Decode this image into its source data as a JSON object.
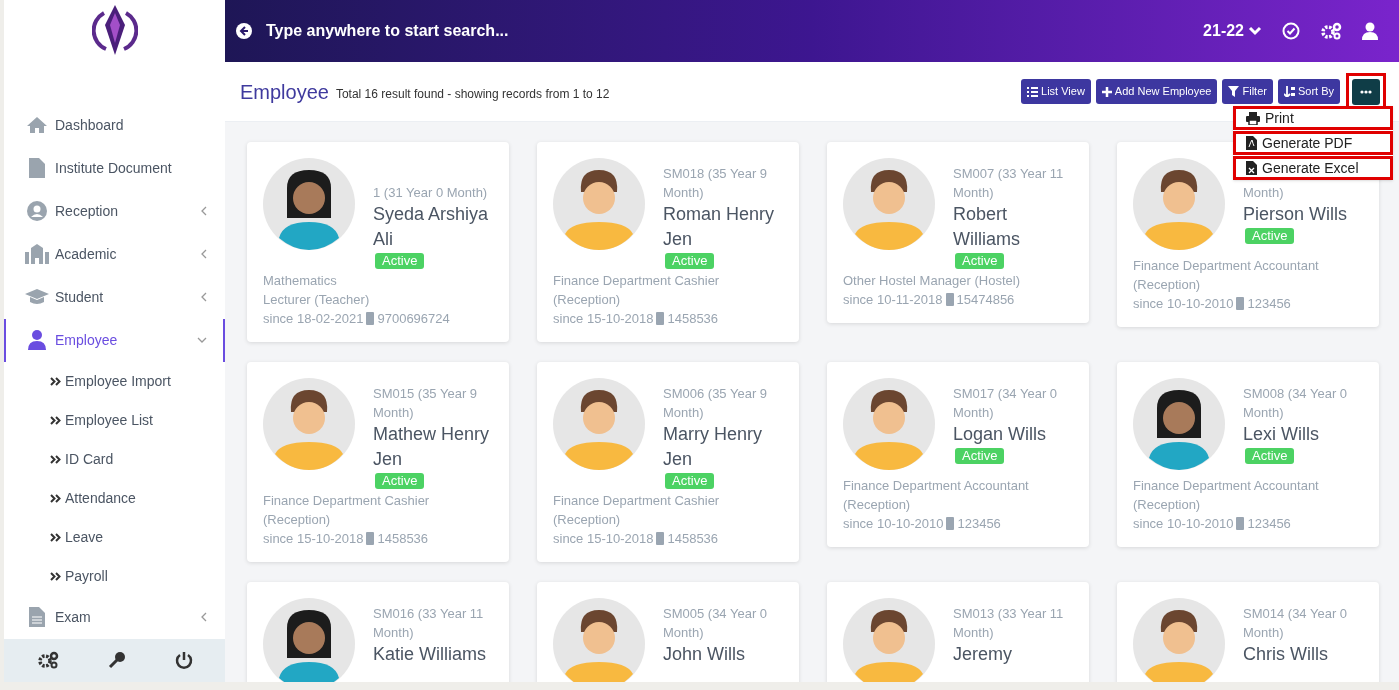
{
  "search": {
    "placeholder": "Type anywhere to start search..."
  },
  "topbar": {
    "session": "21-22"
  },
  "sidebar": {
    "items": [
      {
        "label": "Dashboard",
        "selected": false
      },
      {
        "label": "Institute Document",
        "selected": false
      },
      {
        "label": "Reception",
        "selected": false,
        "expanded": false
      },
      {
        "label": "Academic",
        "selected": false,
        "expanded": false
      },
      {
        "label": "Student",
        "selected": false,
        "expanded": false
      },
      {
        "label": "Employee",
        "selected": true,
        "expanded": true,
        "children": [
          {
            "label": "Employee Import"
          },
          {
            "label": "Employee List"
          },
          {
            "label": "ID Card"
          },
          {
            "label": "Attendance"
          },
          {
            "label": "Leave"
          },
          {
            "label": "Payroll"
          }
        ]
      },
      {
        "label": "Exam",
        "selected": false,
        "expanded": false
      }
    ]
  },
  "page": {
    "title": "Employee",
    "summary": "Total 16 result found - showing records from 1 to 12"
  },
  "toolbar": [
    {
      "label": "List View",
      "highlighted": false
    },
    {
      "label": "Add New Employee",
      "highlighted": false
    },
    {
      "label": "Filter",
      "highlighted": false
    },
    {
      "label": "Sort By",
      "highlighted": false
    }
  ],
  "more_button": {
    "highlighted": true,
    "expanded": true
  },
  "more_menu": [
    {
      "label": "Print",
      "highlighted": true
    },
    {
      "label": "Generate PDF",
      "highlighted": true
    },
    {
      "label": "Generate Excel",
      "highlighted": true
    }
  ],
  "cards": [
    {
      "kind": "female",
      "code": "1 (31 Year 0 Month)",
      "name": "Syeda Arshiya Ali",
      "status": "Active",
      "subject": "Mathematics",
      "role": "Lecturer (Teacher)",
      "since": "since 18-02-2021",
      "phone": "9700696724"
    },
    {
      "kind": "male",
      "code": "SM018 (35 Year 9 Month)",
      "name": "Roman Henry Jen",
      "status": "Active",
      "role": "Finance Department Cashier (Reception)",
      "since": "since 15-10-2018",
      "phone": "1458536"
    },
    {
      "kind": "male",
      "code": "SM007 (33 Year 11 Month)",
      "name": "Robert Williams",
      "status": "Active",
      "role": "Other Hostel Manager (Hostel)",
      "since": "since 10-11-2018",
      "phone": "15474856"
    },
    {
      "kind": "male",
      "code": "Month)",
      "name": "Pierson Wills",
      "status": "Active",
      "role": "Finance Department Accountant (Reception)",
      "since": "since 10-10-2010",
      "phone": "123456"
    },
    {
      "kind": "male",
      "code": "SM015 (35 Year 9 Month)",
      "name": "Mathew Henry Jen",
      "status": "Active",
      "role": "Finance Department Cashier (Reception)",
      "since": "since 15-10-2018",
      "phone": "1458536"
    },
    {
      "kind": "male",
      "code": "SM006 (35 Year 9 Month)",
      "name": "Marry Henry Jen",
      "status": "Active",
      "role": "Finance Department Cashier (Reception)",
      "since": "since 15-10-2018",
      "phone": "1458536"
    },
    {
      "kind": "male",
      "code": "SM017 (34 Year 0 Month)",
      "name": "Logan Wills",
      "status": "Active",
      "role": "Finance Department Accountant (Reception)",
      "since": "since 10-10-2010",
      "phone": "123456"
    },
    {
      "kind": "female",
      "code": "SM008 (34 Year 0 Month)",
      "name": "Lexi Wills",
      "status": "Active",
      "role": "Finance Department Accountant (Reception)",
      "since": "since 10-10-2010",
      "phone": "123456"
    },
    {
      "kind": "female",
      "code": "SM016 (33 Year 11 Month)",
      "name": "Katie Williams"
    },
    {
      "kind": "male",
      "code": "SM005 (34 Year 0 Month)",
      "name": "John Wills"
    },
    {
      "kind": "male",
      "code": "SM013 (33 Year 11 Month)",
      "name": "Jeremy"
    },
    {
      "kind": "male",
      "code": "SM014 (34 Year 0 Month)",
      "name": "Chris Wills"
    }
  ]
}
